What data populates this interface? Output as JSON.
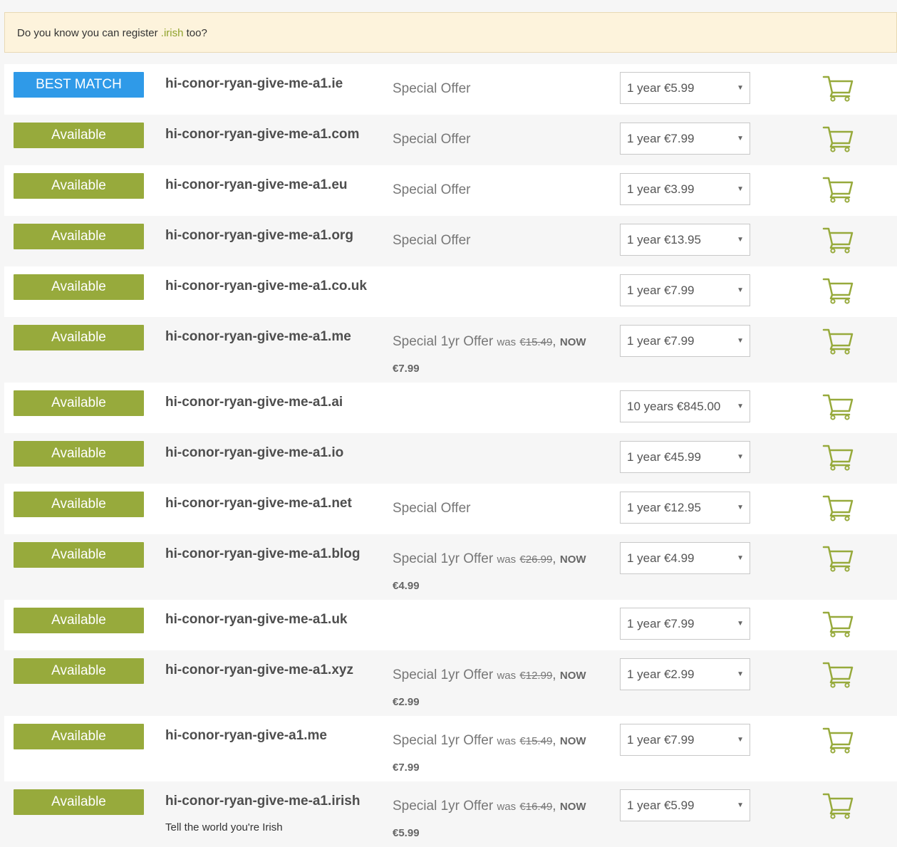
{
  "notice": {
    "prefix": "Do you know you can register ",
    "tld": ".irish",
    "suffix": " too?"
  },
  "rows": [
    {
      "badge": "BEST MATCH",
      "badge_type": "best",
      "domain": "hi-conor-ryan-give-me-a1.ie",
      "offer": "Special Offer",
      "period": "1 year €5.99",
      "tall": false
    },
    {
      "badge": "Available",
      "badge_type": "avail",
      "domain": "hi-conor-ryan-give-me-a1.com",
      "offer": "Special Offer",
      "period": "1 year €7.99",
      "tall": false
    },
    {
      "badge": "Available",
      "badge_type": "avail",
      "domain": "hi-conor-ryan-give-me-a1.eu",
      "offer": "Special Offer",
      "period": "1 year €3.99",
      "tall": false
    },
    {
      "badge": "Available",
      "badge_type": "avail",
      "domain": "hi-conor-ryan-give-me-a1.org",
      "offer": "Special Offer",
      "period": "1 year €13.95",
      "tall": false
    },
    {
      "badge": "Available",
      "badge_type": "avail",
      "domain": "hi-conor-ryan-give-me-a1.co.uk",
      "offer": "",
      "period": "1 year €7.99",
      "tall": false
    },
    {
      "badge": "Available",
      "badge_type": "avail",
      "domain": "hi-conor-ryan-give-me-a1.me",
      "offer": "Special 1yr Offer",
      "was_label": "was",
      "was_price": "€15.49",
      "now_label": "NOW",
      "now_price": "€7.99",
      "period": "1 year €7.99",
      "tall": true
    },
    {
      "badge": "Available",
      "badge_type": "avail",
      "domain": "hi-conor-ryan-give-me-a1.ai",
      "offer": "",
      "period": "10 years €845.00",
      "tall": false
    },
    {
      "badge": "Available",
      "badge_type": "avail",
      "domain": "hi-conor-ryan-give-me-a1.io",
      "offer": "",
      "period": "1 year €45.99",
      "tall": false
    },
    {
      "badge": "Available",
      "badge_type": "avail",
      "domain": "hi-conor-ryan-give-me-a1.net",
      "offer": "Special Offer",
      "period": "1 year €12.95",
      "tall": false
    },
    {
      "badge": "Available",
      "badge_type": "avail",
      "domain": "hi-conor-ryan-give-me-a1.blog",
      "offer": "Special 1yr Offer",
      "was_label": "was",
      "was_price": "€26.99",
      "now_label": "NOW",
      "now_price": "€4.99",
      "period": "1 year €4.99",
      "tall": true
    },
    {
      "badge": "Available",
      "badge_type": "avail",
      "domain": "hi-conor-ryan-give-me-a1.uk",
      "offer": "",
      "period": "1 year €7.99",
      "tall": false
    },
    {
      "badge": "Available",
      "badge_type": "avail",
      "domain": "hi-conor-ryan-give-me-a1.xyz",
      "offer": "Special 1yr Offer",
      "was_label": "was",
      "was_price": "€12.99",
      "now_label": "NOW",
      "now_price": "€2.99",
      "period": "1 year €2.99",
      "tall": true
    },
    {
      "badge": "Available",
      "badge_type": "avail",
      "domain": "hi-conor-ryan-give-a1.me",
      "offer": "Special 1yr Offer",
      "was_label": "was",
      "was_price": "€15.49",
      "now_label": "NOW",
      "now_price": "€7.99",
      "period": "1 year €7.99",
      "tall": true
    },
    {
      "badge": "Available",
      "badge_type": "avail",
      "domain": "hi-conor-ryan-give-me-a1.irish",
      "subtext": "Tell the world you're Irish",
      "offer": "Special 1yr Offer",
      "was_label": "was",
      "was_price": "€16.49",
      "now_label": "NOW",
      "now_price": "€5.99",
      "period": "1 year €5.99",
      "tall": true
    }
  ],
  "icons": {
    "dropdown": "caret-down-icon",
    "cart": "shopping-cart-icon"
  },
  "colors": {
    "available": "#97aa3c",
    "best_match": "#2f9ae8",
    "cart": "#97aa3c",
    "notice_bg": "#fdf3dc",
    "tld_accent": "#8fa22b"
  }
}
